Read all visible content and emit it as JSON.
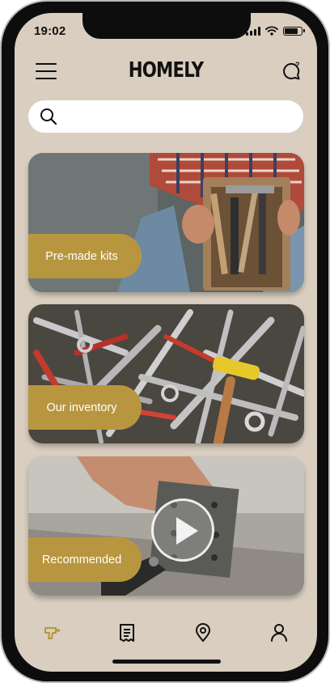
{
  "status_bar": {
    "time": "19:02"
  },
  "header": {
    "title": "HOMELY"
  },
  "search": {
    "placeholder": ""
  },
  "cards": [
    {
      "label": "Pre-made kits"
    },
    {
      "label": "Our inventory"
    },
    {
      "label": "Recommended"
    }
  ],
  "tabs": [
    {
      "icon": "drill-icon",
      "active": true
    },
    {
      "icon": "receipt-icon",
      "active": false
    },
    {
      "icon": "location-pin-icon",
      "active": false
    },
    {
      "icon": "user-icon",
      "active": false
    }
  ],
  "colors": {
    "background": "#d9cebf",
    "accent": "#b8963f",
    "text": "#111111"
  }
}
